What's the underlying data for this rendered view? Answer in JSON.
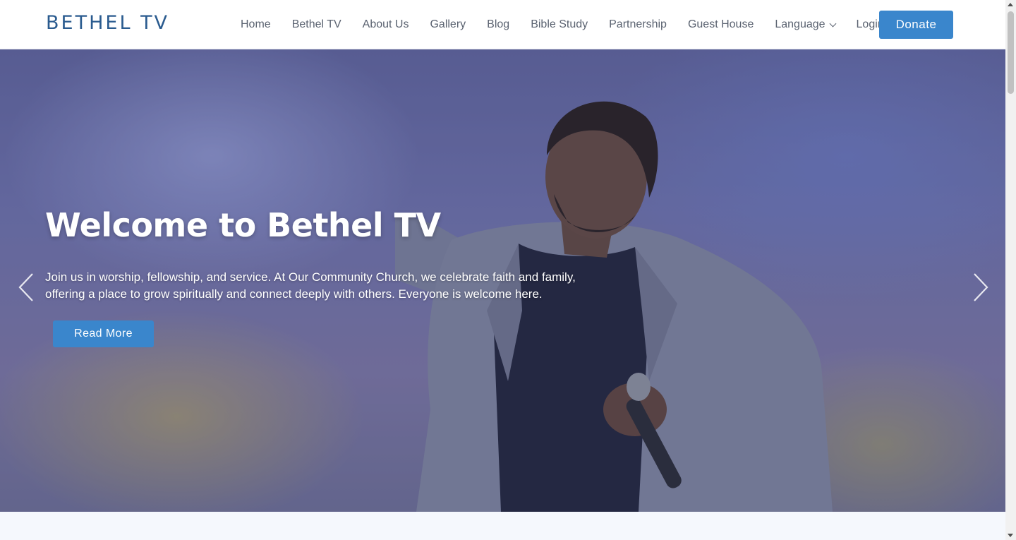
{
  "brand": {
    "name": "BETHEL TV"
  },
  "nav": {
    "items": [
      {
        "label": "Home"
      },
      {
        "label": "Bethel TV"
      },
      {
        "label": "About Us"
      },
      {
        "label": "Gallery"
      },
      {
        "label": "Blog"
      },
      {
        "label": "Bible Study"
      },
      {
        "label": "Partnership"
      },
      {
        "label": "Guest House"
      },
      {
        "label": "Language"
      },
      {
        "label": "Login"
      }
    ],
    "donate_label": "Donate"
  },
  "hero": {
    "title": "Welcome to Bethel TV",
    "text": "Join us in worship, fellowship, and service. At Our Community Church, we celebrate faith and family, offering a place to grow spiritually and connect deeply with others. Everyone is welcome here.",
    "button_label": "Read More",
    "prev_icon": "chevron-left-icon",
    "next_icon": "chevron-right-icon"
  },
  "colors": {
    "brand": "#2a5b8f",
    "accent": "#3a86cc",
    "nav_text": "#5a6270"
  }
}
